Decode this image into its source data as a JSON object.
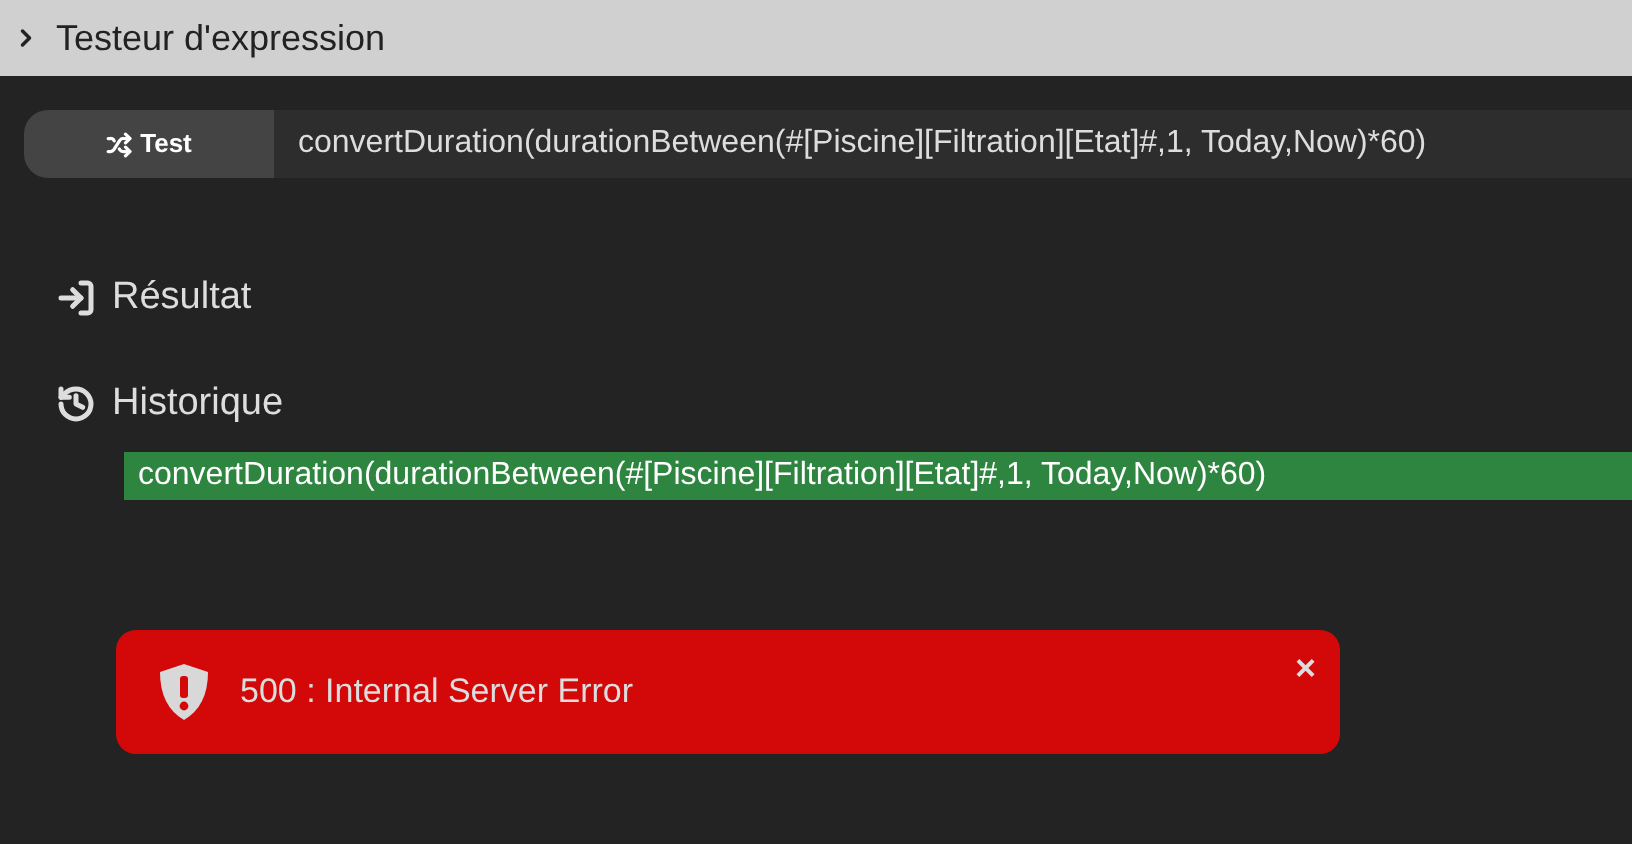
{
  "panel": {
    "title": "Testeur d'expression"
  },
  "test_button": {
    "label": "Test"
  },
  "expression_field": {
    "value": "convertDuration(durationBetween(#[Piscine][Filtration][Etat]#,1, Today,Now)*60)"
  },
  "result": {
    "heading": "Résultat"
  },
  "history": {
    "heading": "Historique",
    "items": [
      {
        "text": "convertDuration(durationBetween(#[Piscine][Filtration][Etat]#,1, Today,Now)*60)"
      }
    ]
  },
  "error": {
    "message": "500 : Internal Server Error",
    "close": "×"
  }
}
